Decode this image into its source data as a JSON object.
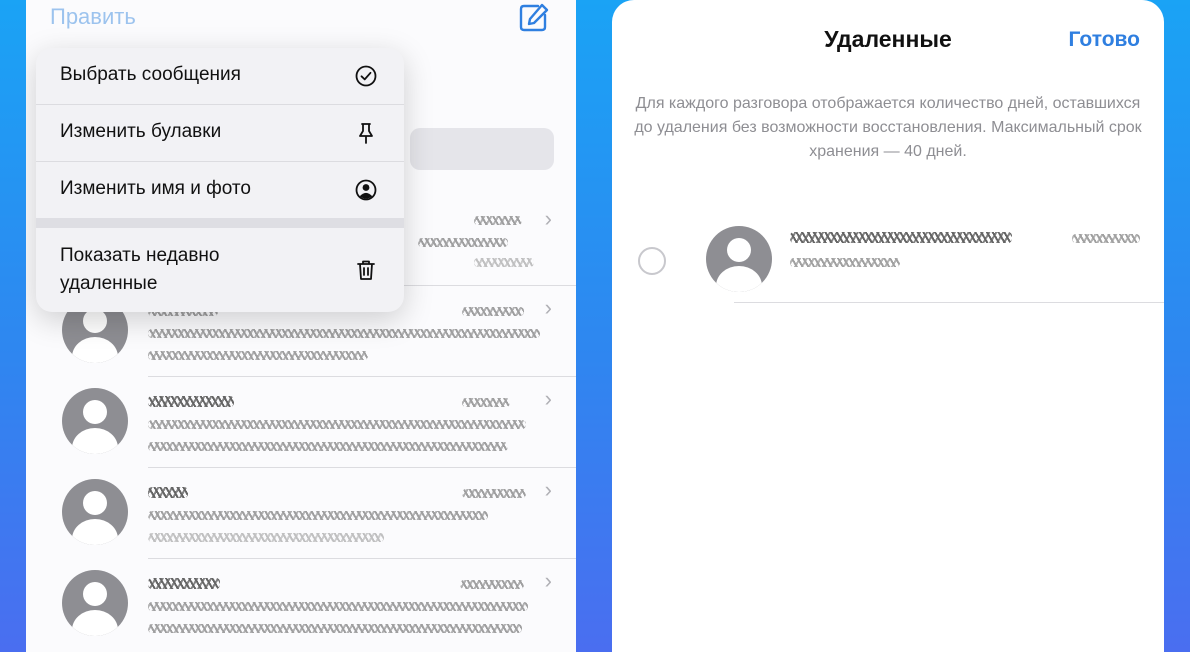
{
  "left": {
    "edit_label": "Править",
    "menu": {
      "items": [
        {
          "label": "Выбрать сообщения",
          "icon": "checkmark-circle-icon"
        },
        {
          "label": "Изменить булавки",
          "icon": "pin-icon"
        },
        {
          "label": "Изменить имя и фото",
          "icon": "person-circle-icon"
        },
        {
          "label": "Показать недавно удаленные",
          "icon": "trash-icon"
        }
      ]
    }
  },
  "right": {
    "title": "Удаленные",
    "done_label": "Готово",
    "info_text": "Для каждого разговора отображается количество дней, оставшихся до удаления без возможности восстановления. Максимальный срок хранения — 40 дней."
  },
  "colors": {
    "accent": "#2f7fe0",
    "background_gradient_top": "#1aa3f5",
    "background_gradient_bottom": "#4a6ef0"
  }
}
